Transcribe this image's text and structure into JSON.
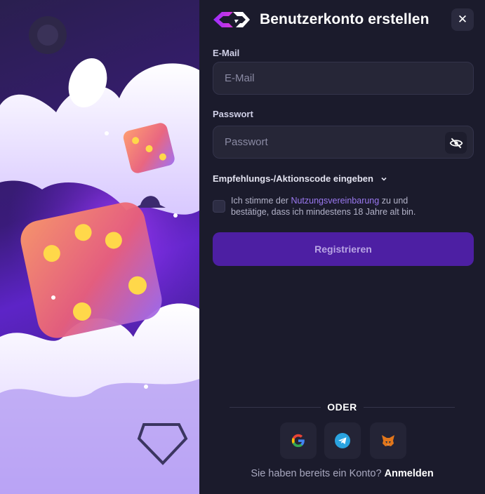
{
  "dialog": {
    "title": "Benutzerkonto erstellen",
    "close_label": "✕"
  },
  "form": {
    "email_label": "E-Mail",
    "email_placeholder": "E-Mail",
    "email_value": "",
    "password_label": "Passwort",
    "password_placeholder": "Passwort",
    "password_value": "",
    "promo_label": "Empfehlungs-/Aktionscode eingeben",
    "terms_prefix": "Ich stimme der ",
    "terms_link": "Nutzungsvereinbarung",
    "terms_suffix": " zu und bestätige, dass ich mindestens 18 Jahre alt bin.",
    "register_label": "Registrieren"
  },
  "social": {
    "divider_label": "ODER",
    "providers": [
      "google-icon",
      "telegram-icon",
      "metamask-icon"
    ]
  },
  "footer": {
    "question": "Sie haben bereits ein Konto?",
    "signin_label": "Anmelden"
  },
  "colors": {
    "accent": "#4d1fa3",
    "link": "#9a78f0",
    "panel_bg": "#1b1b2c",
    "field_bg": "#262637"
  }
}
